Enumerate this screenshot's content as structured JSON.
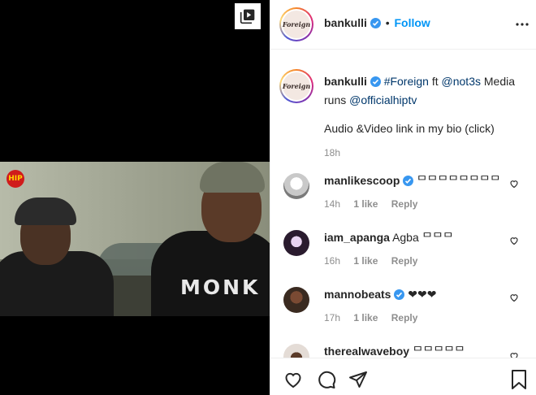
{
  "post": {
    "author": "bankulli",
    "follow_label": "Follow",
    "avatar_text": "Foreign",
    "video_overlay_text": "MONK",
    "video_logo_text": "HIP"
  },
  "caption": {
    "author": "bankulli",
    "hashtag": "#Foreign",
    "ft": " ft ",
    "mention1": "@not3s",
    "text1": " Media runs ",
    "mention2": "@officialhiptv",
    "text2": "Audio &Video link in my bio (click)",
    "time": "18h"
  },
  "comments": [
    {
      "user": "manlikescoop",
      "text": "ᄆᄆᄆᄆᄆᄆᄆᄆ",
      "time": "14h",
      "likes": "1 like",
      "reply": "Reply",
      "verified": true
    },
    {
      "user": "iam_apanga",
      "text": "Agba ᄆᄆᄆ",
      "time": "16h",
      "likes": "1 like",
      "reply": "Reply",
      "verified": false
    },
    {
      "user": "mannobeats",
      "text": "❤❤❤",
      "time": "17h",
      "likes": "1 like",
      "reply": "Reply",
      "verified": true
    },
    {
      "user": "therealwaveboy",
      "text": "ᄆᄆᄆᄆᄆ",
      "time": "",
      "likes": "",
      "reply": "",
      "verified": false
    }
  ],
  "colors": {
    "accent": "#0095f6",
    "verified": "#3897f0",
    "muted": "#8e8e8e",
    "text": "#262626"
  },
  "icons": [
    "video-icon",
    "verified-icon",
    "more-icon",
    "heart-icon",
    "comment-icon",
    "share-icon",
    "bookmark-icon"
  ]
}
